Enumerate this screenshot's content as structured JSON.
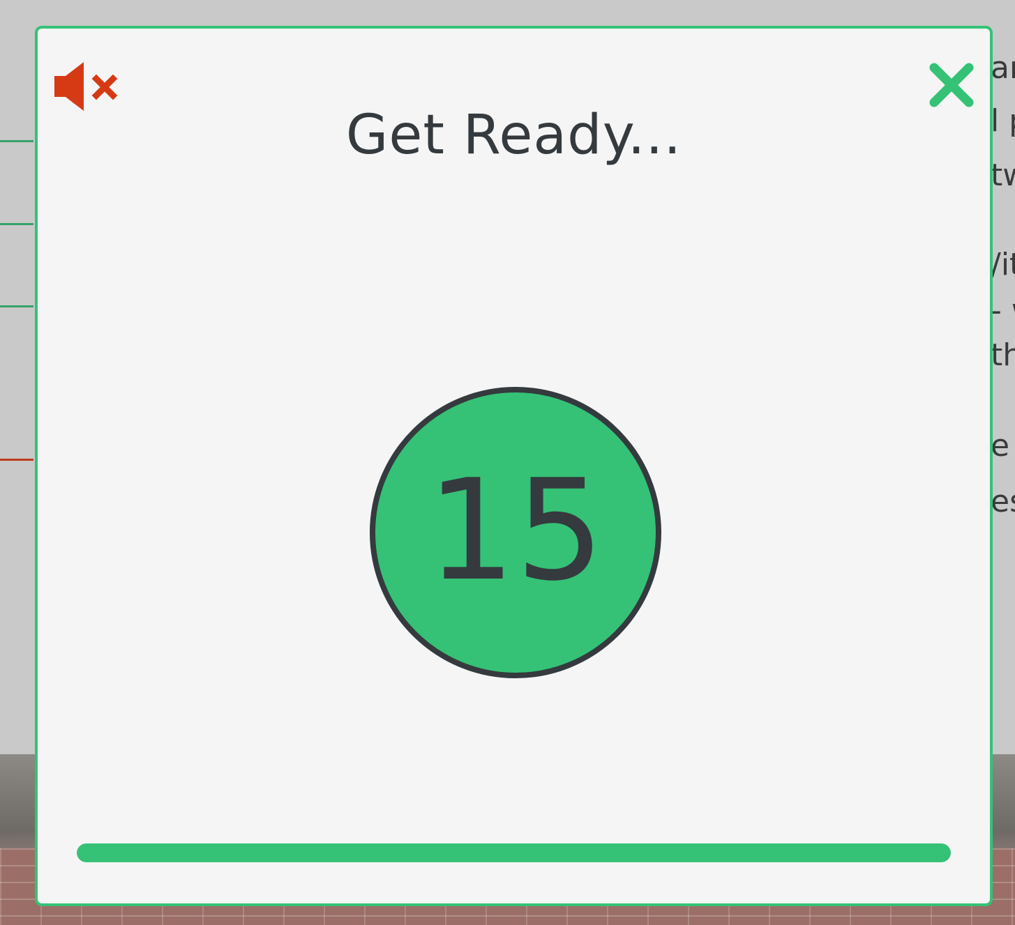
{
  "background_page": {
    "right_edge_text_fragments": [
      "ar",
      "l p",
      "tw",
      "/it",
      "- w",
      "th",
      "e",
      "es"
    ]
  },
  "modal": {
    "title": "Get Ready...",
    "countdown_value": "15",
    "progress_fraction": 1.0,
    "mute_icon": "speaker-muted-icon",
    "close_icon": "close-icon"
  },
  "colors": {
    "accent_green": "#35c276",
    "mute_red": "#d63a14",
    "text_dark": "#343a3e",
    "modal_bg": "#f5f5f5"
  }
}
